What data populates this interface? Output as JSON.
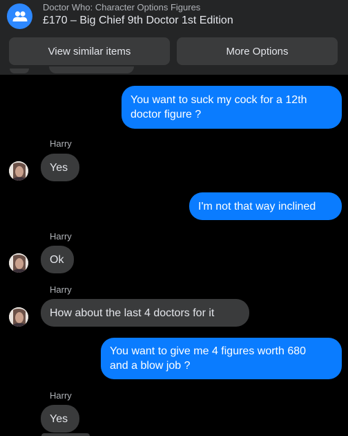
{
  "header": {
    "listing_category": "Doctor Who: Character Options Figures",
    "listing_title": "£170 – Big Chief 9th Doctor 1st Edition",
    "icon": "group-icon",
    "buttons": {
      "view_similar": "View similar items",
      "more_options": "More Options"
    }
  },
  "messages": [
    {
      "direction": "outgoing",
      "lines": [
        "You want to suck my cock for a 12th",
        "doctor figure ?"
      ]
    },
    {
      "direction": "incoming",
      "sender": "Harry",
      "text": "Yes"
    },
    {
      "direction": "outgoing",
      "text": "I'm not that way inclined"
    },
    {
      "direction": "incoming",
      "sender": "Harry",
      "text": "Ok"
    },
    {
      "direction": "incoming",
      "sender": "Harry",
      "text": "How about the last 4 doctors for it"
    },
    {
      "direction": "outgoing",
      "lines": [
        "You want to give me 4 figures worth 680",
        "and a blow job ?"
      ]
    },
    {
      "direction": "incoming",
      "sender": "Harry",
      "text": "Yes"
    }
  ],
  "colors": {
    "outgoing_bubble": "#0a7cff",
    "incoming_bubble": "#3a3b3c",
    "header_bg": "#242526",
    "background": "#000000"
  }
}
